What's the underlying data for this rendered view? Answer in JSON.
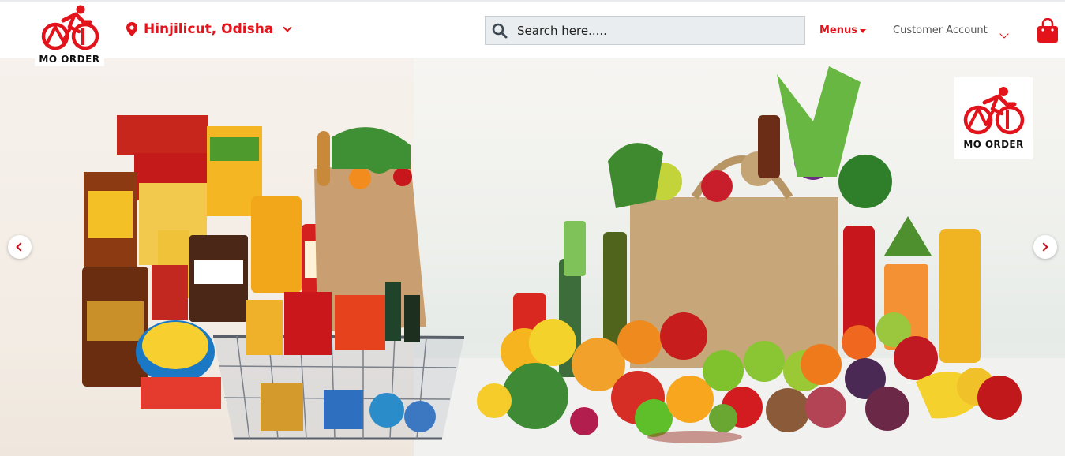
{
  "brand": {
    "name": "MO ORDER",
    "accent": "#e3131b"
  },
  "header": {
    "location": "Hinjilicut, Odisha",
    "search_placeholder": "Search here.....",
    "menus_label": "Menus",
    "account_label": "Customer Account"
  },
  "icons": {
    "location": "map-pin-icon",
    "search": "magnifier-icon",
    "cart": "shopping-bag-icon",
    "prev": "chevron-left-icon",
    "next": "chevron-right-icon"
  },
  "hero": {
    "badge_text": "MO ORDER"
  }
}
